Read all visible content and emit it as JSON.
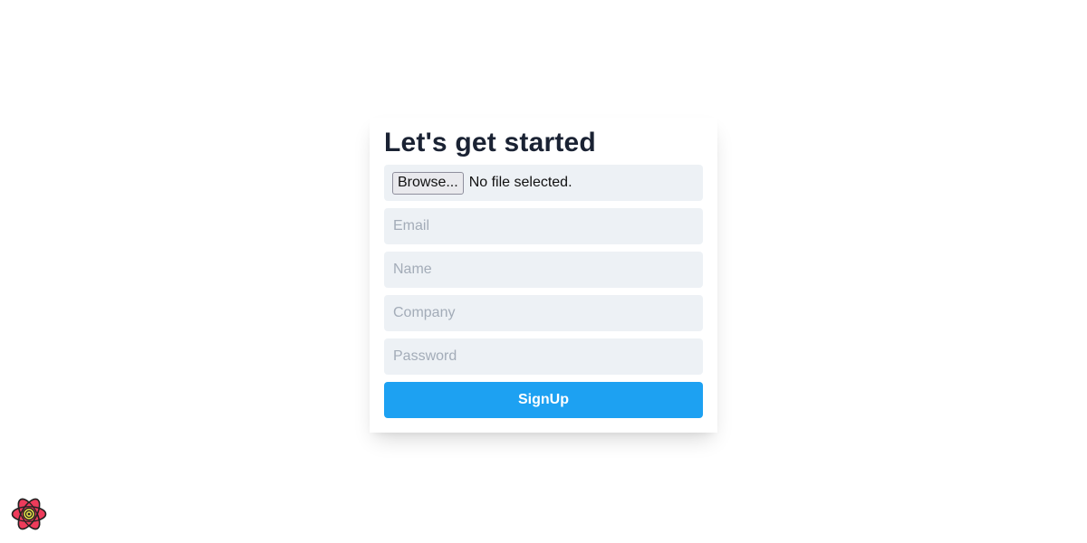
{
  "signup_card": {
    "title": "Let's get started",
    "file_input": {
      "button_label": "Browse...",
      "status": "No file selected."
    },
    "email_placeholder": "Email",
    "name_placeholder": "Name",
    "company_placeholder": "Company",
    "password_placeholder": "Password",
    "submit_label": "SignUp"
  },
  "devtools": {
    "icon": "react-logo-icon"
  },
  "colors": {
    "accent": "#1da1f2",
    "field_background": "#edf1f5",
    "title_text": "#1a2233",
    "placeholder_text": "#a3acb8"
  }
}
